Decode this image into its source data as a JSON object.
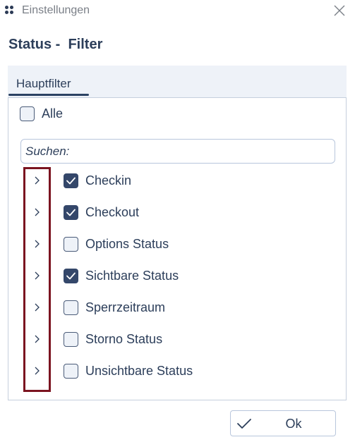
{
  "window": {
    "title": "Einstellungen",
    "app_icon": "app-dots-icon",
    "close_icon": "close-icon"
  },
  "dialog": {
    "title": "Status -  Filter"
  },
  "tabs": [
    {
      "label": "Hauptfilter",
      "active": true
    }
  ],
  "filter": {
    "all_label": "Alle",
    "all_checked": false,
    "search_placeholder": "Suchen:",
    "search_value": "",
    "items": [
      {
        "label": "Checkin",
        "checked": true
      },
      {
        "label": "Checkout",
        "checked": true
      },
      {
        "label": "Options Status",
        "checked": false
      },
      {
        "label": "Sichtbare Status",
        "checked": true
      },
      {
        "label": "Sperrzeitraum",
        "checked": false
      },
      {
        "label": "Storno Status",
        "checked": false
      },
      {
        "label": "Unsichtbare Status",
        "checked": false
      }
    ]
  },
  "footer": {
    "ok_label": "Ok",
    "ok_icon": "checkmark-icon"
  },
  "colors": {
    "accent": "#34476a",
    "highlight": "#7b1420",
    "tab_strip": "#eef2f8"
  }
}
